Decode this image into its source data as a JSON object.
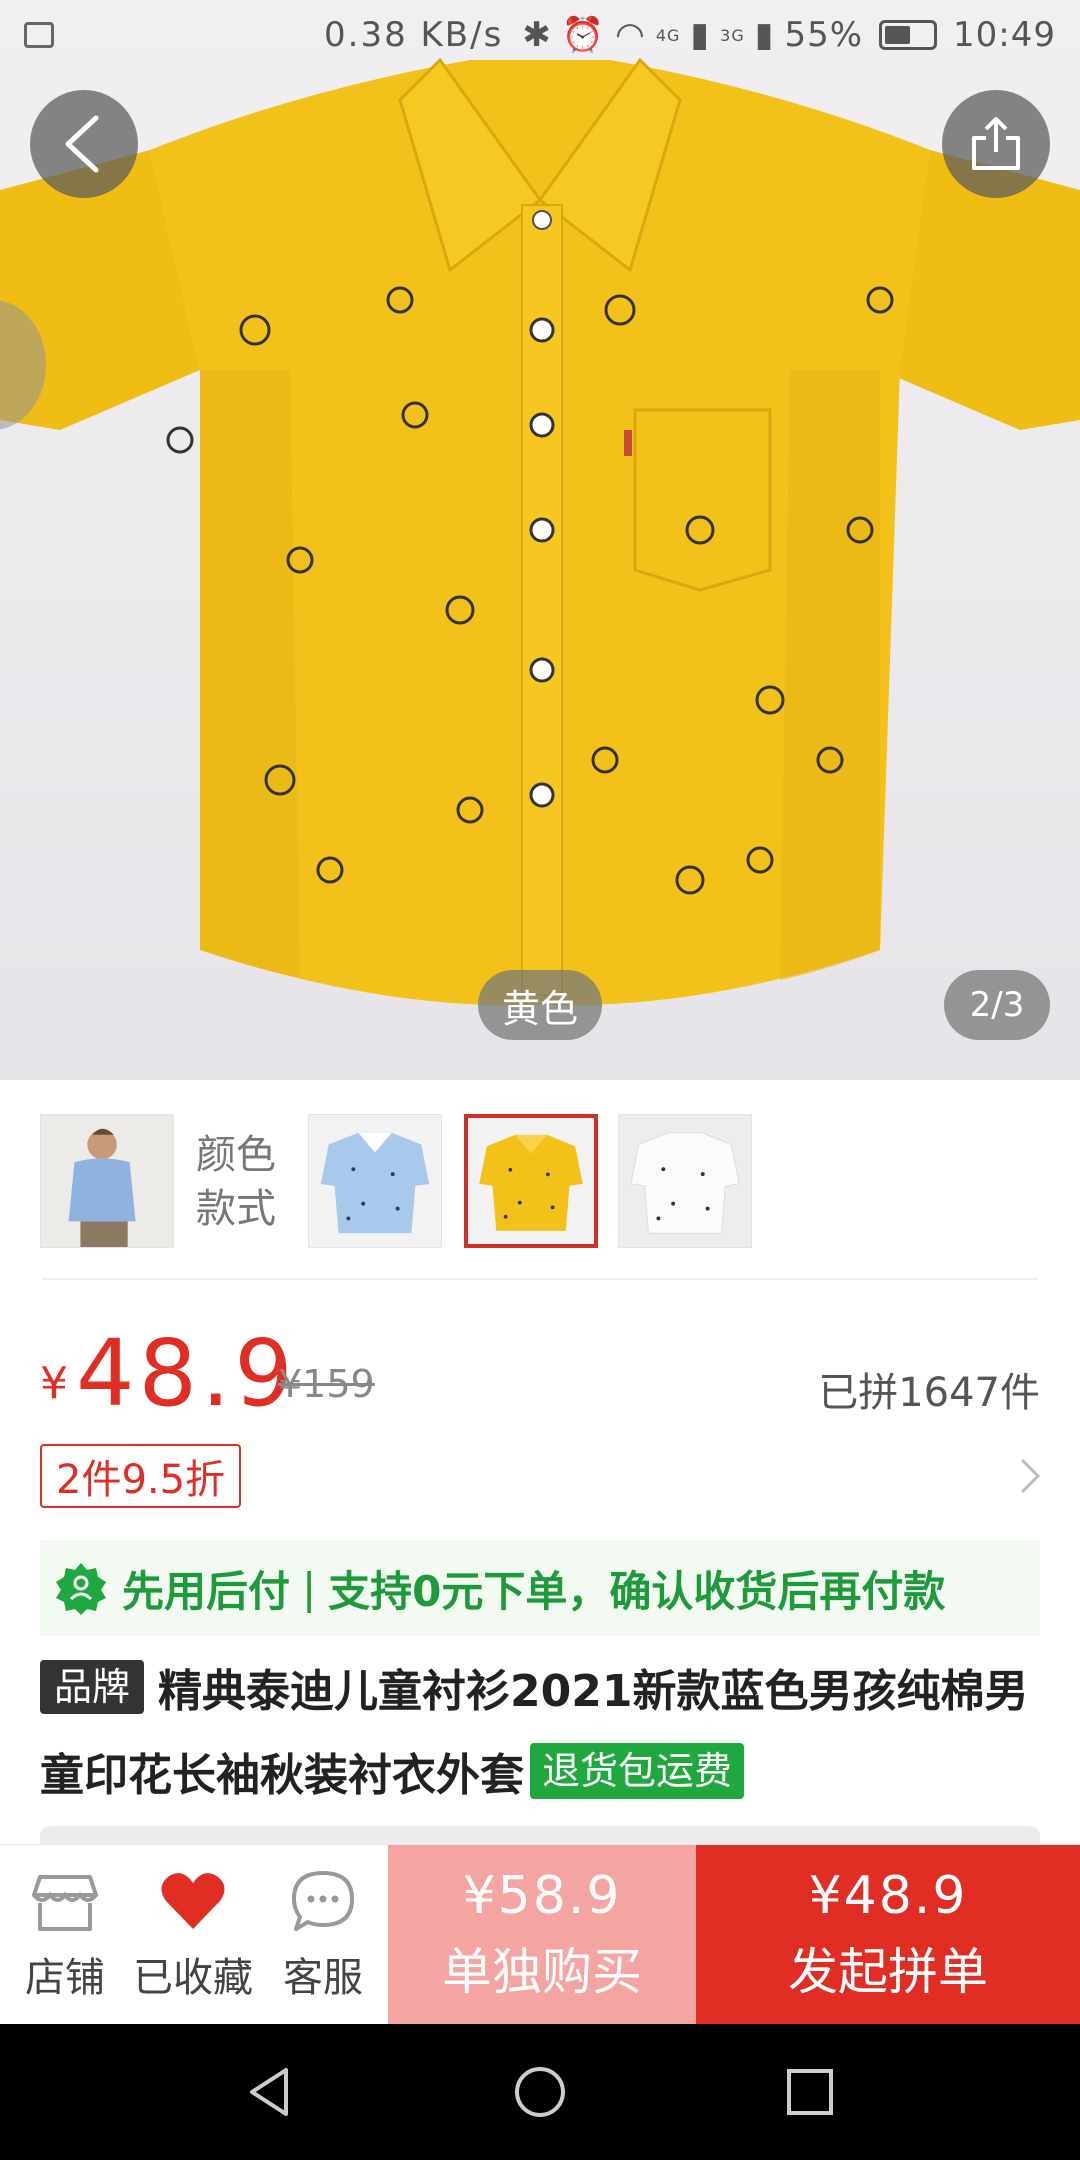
{
  "status_bar": {
    "speed": "0.38 KB/s",
    "network_4g": "4G",
    "network_3g": "3G",
    "battery": "55%",
    "time": "10:49"
  },
  "hero": {
    "color_label": "黄色",
    "page_counter": "2/3",
    "icons": [
      "back-arrow-icon",
      "share-icon"
    ]
  },
  "variants": {
    "label": "颜色款式",
    "options": [
      "blue-model-photo",
      "light-blue-shirt",
      "yellow-shirt",
      "white-shirt"
    ],
    "selected_index": 2
  },
  "price": {
    "currency": "¥",
    "current": "48.9",
    "original": "¥159",
    "sold_count": "已拼1647件",
    "discount_tag": "2件9.5折"
  },
  "pay_later": {
    "label": "先用后付",
    "separator": "|",
    "description": "支持0元下单，确认收货后再付款"
  },
  "product": {
    "brand_tag": "品牌",
    "title": "精典泰迪儿童衬衫2021新款蓝色男孩纯棉男童印花长袖秋装衬衣外套",
    "return_tag": "退货包运费"
  },
  "bottom_bar": {
    "store_label": "店铺",
    "favorited_label": "已收藏",
    "service_label": "客服",
    "solo_price": "¥58.9",
    "solo_label": "单独购买",
    "group_price": "¥48.9",
    "group_label": "发起拼单"
  },
  "colors": {
    "accent_red": "#e02e24",
    "solo_pink": "#f5a5a1",
    "pay_green": "#1d9a3a",
    "shirt_yellow": "#f3c21a"
  }
}
